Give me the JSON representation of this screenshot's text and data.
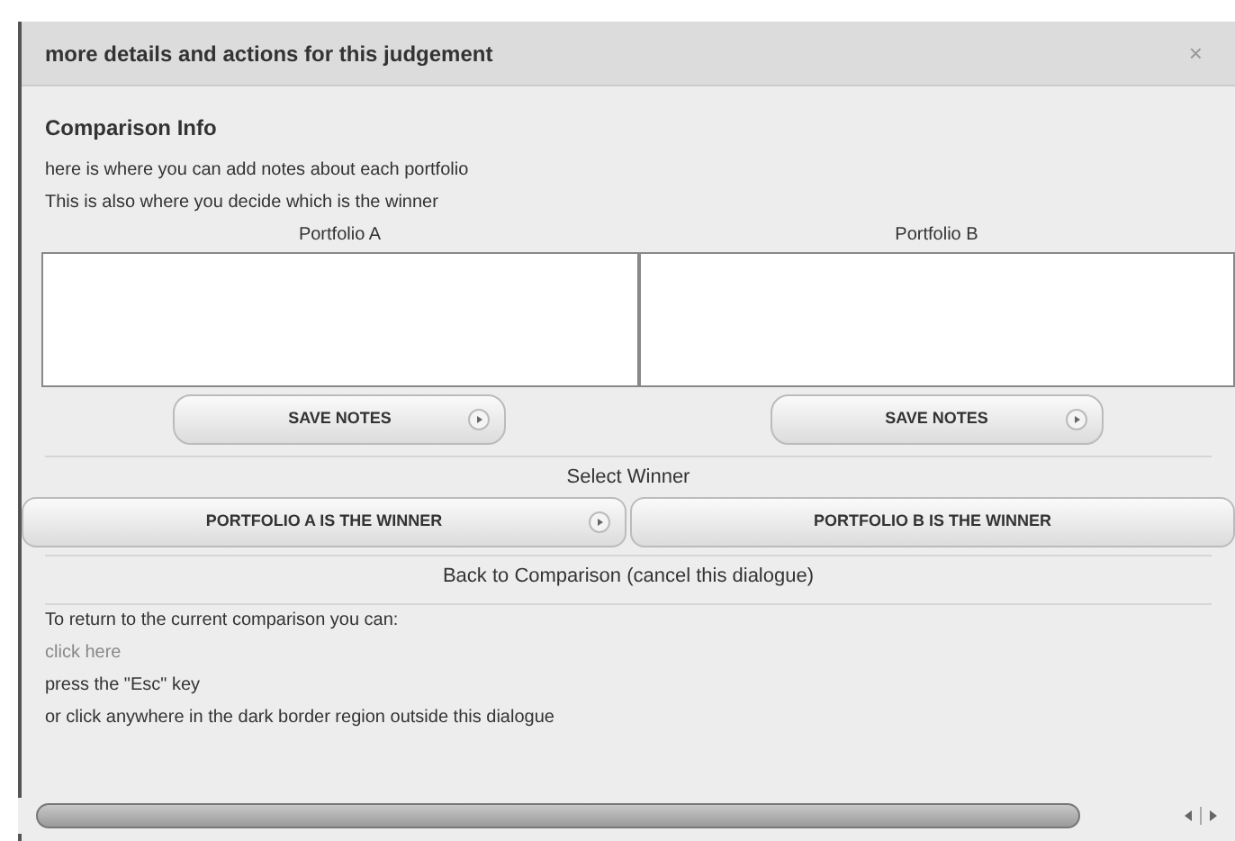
{
  "dialog": {
    "title": "more details and actions for this judgement",
    "close": "×"
  },
  "section_title": "Comparison Info",
  "intro": [
    "here is where you can add notes about each portfolio",
    "This is also where you decide which is the winner"
  ],
  "portfolios": [
    {
      "label": "Portfolio A",
      "save_button": "SAVE NOTES"
    },
    {
      "label": "Portfolio B",
      "save_button": "SAVE NOTES"
    }
  ],
  "select_label": "Select Winner",
  "winner_buttons": [
    {
      "label": "PORTFOLIO A IS THE WINNER",
      "arrow": true
    },
    {
      "label": "PORTFOLIO B IS THE WINNER",
      "arrow": false
    }
  ],
  "back_label": "Back to Comparison (cancel this dialogue)",
  "return_intro": "To return to the current comparison you can:",
  "return_options": [
    {
      "kind": "link",
      "text": "click here"
    },
    {
      "kind": "text",
      "text": "press the \"Esc\" key"
    },
    {
      "kind": "text",
      "text": "or click anywhere in the dark border region outside this dialogue"
    }
  ]
}
